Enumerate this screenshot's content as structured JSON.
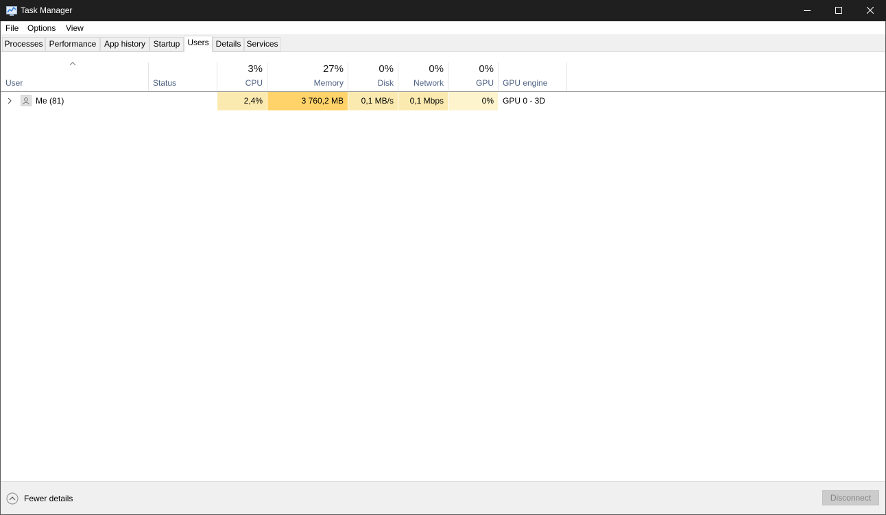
{
  "window": {
    "title": "Task Manager",
    "icon": "task-manager-icon"
  },
  "menu": [
    "File",
    "Options",
    "View"
  ],
  "tabs": [
    {
      "label": "Processes",
      "active": false
    },
    {
      "label": "Performance",
      "active": false
    },
    {
      "label": "App history",
      "active": false
    },
    {
      "label": "Startup",
      "active": false
    },
    {
      "label": "Users",
      "active": true
    },
    {
      "label": "Details",
      "active": false
    },
    {
      "label": "Services",
      "active": false
    }
  ],
  "columns": {
    "user": {
      "label": "User"
    },
    "status": {
      "label": "Status"
    },
    "cpu": {
      "percent": "3%",
      "label": "CPU"
    },
    "memory": {
      "percent": "27%",
      "label": "Memory"
    },
    "disk": {
      "percent": "0%",
      "label": "Disk"
    },
    "network": {
      "percent": "0%",
      "label": "Network"
    },
    "gpu": {
      "percent": "0%",
      "label": "GPU"
    },
    "gpu_engine": {
      "label": "GPU engine"
    }
  },
  "rows": [
    {
      "user": "Me (81)",
      "status": "",
      "cpu": "2,4%",
      "memory": "3 760,2 MB",
      "disk": "0,1 MB/s",
      "network": "0,1 Mbps",
      "gpu": "0%",
      "gpu_engine": "GPU 0 - 3D"
    }
  ],
  "heat_colors": {
    "cpu": "#fbeab0",
    "memory": "#ffd36a",
    "disk": "#fbeab0",
    "network": "#fbeab0",
    "gpu": "#fdf3cd"
  },
  "footer": {
    "fewer_details": "Fewer details",
    "disconnect": "Disconnect"
  }
}
